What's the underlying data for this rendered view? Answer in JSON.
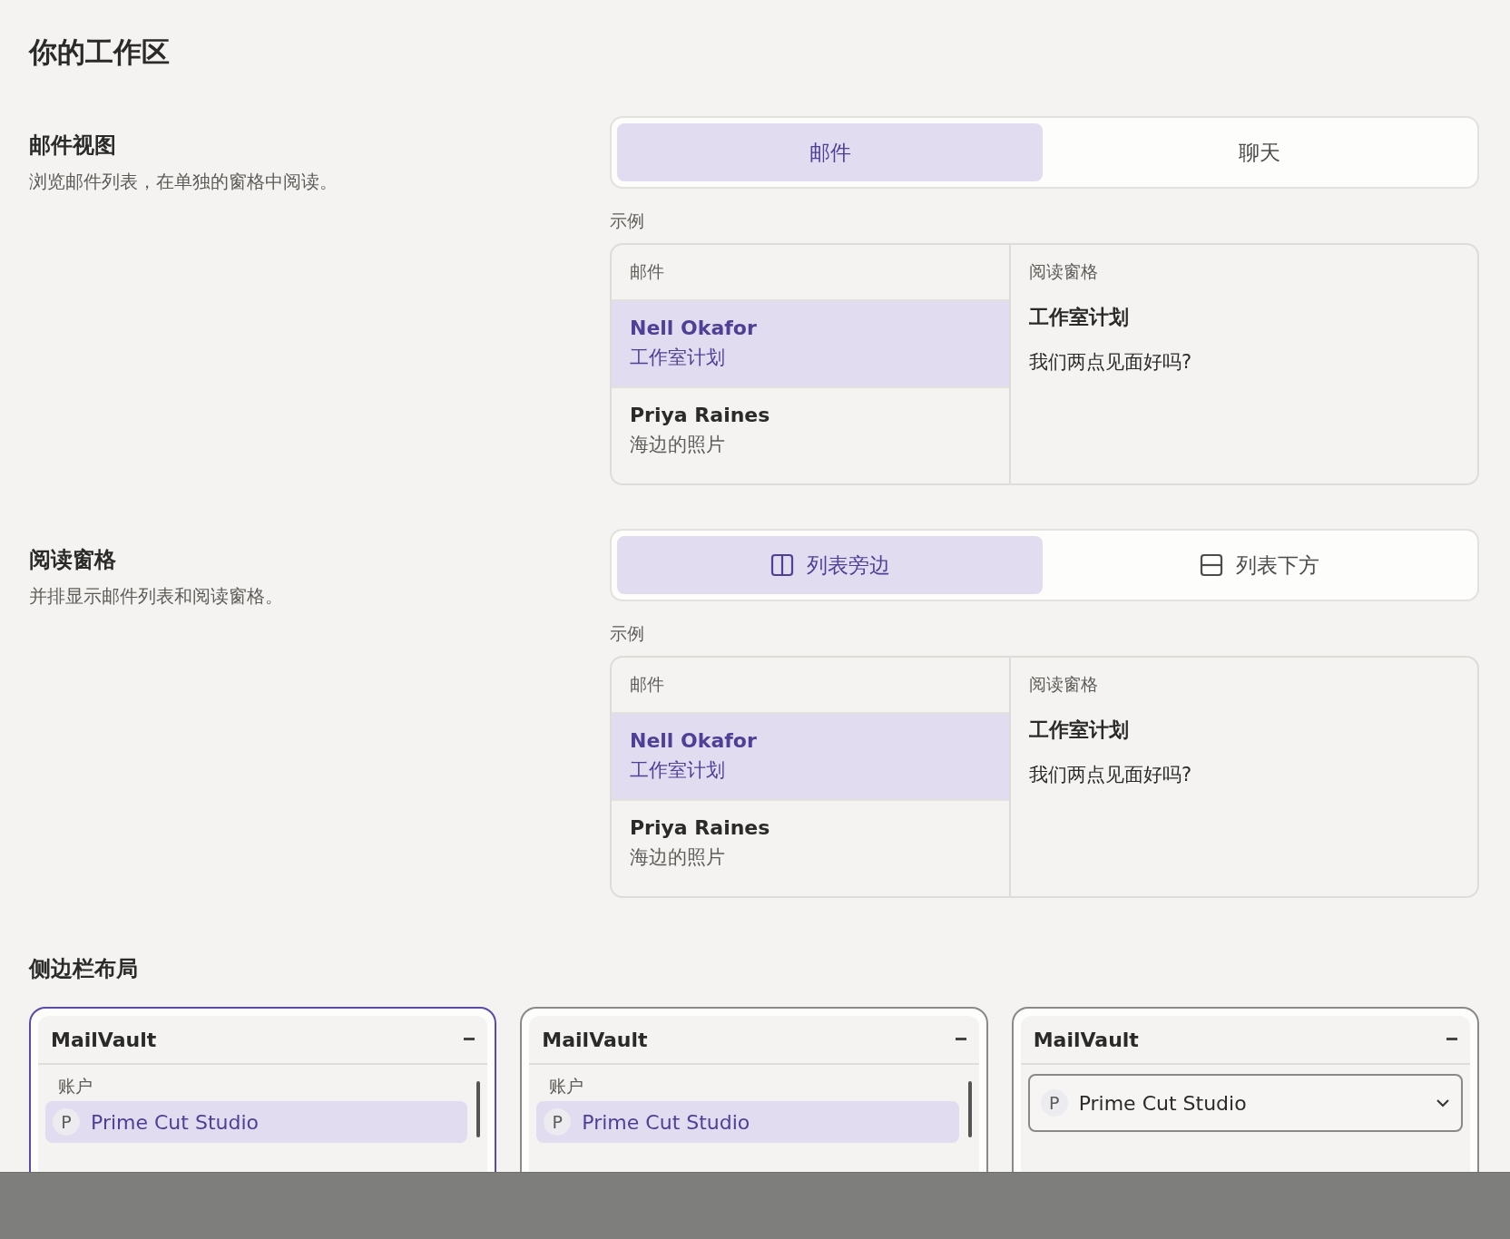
{
  "title": "你的工作区",
  "sections": [
    {
      "title": "邮件视图",
      "description": "浏览邮件列表，在单独的窗格中阅读。",
      "options": [
        {
          "label": "邮件",
          "kind": "plain",
          "selected": true
        },
        {
          "label": "聊天",
          "kind": "plain",
          "selected": false
        }
      ],
      "example_label": "示例",
      "example": {
        "list_header": "邮件",
        "messages": [
          {
            "sender": "Nell Okafor",
            "subject": "工作室计划",
            "selected": true
          },
          {
            "sender": "Priya Raines",
            "subject": "海边的照片",
            "selected": false
          }
        ],
        "pane_header": "阅读窗格",
        "pane_subject": "工作室计划",
        "pane_body": "我们两点见面好吗?"
      }
    },
    {
      "title": "阅读窗格",
      "description": "并排显示邮件列表和阅读窗格。",
      "options": [
        {
          "label": "列表旁边",
          "kind": "columns",
          "selected": true
        },
        {
          "label": "列表下方",
          "kind": "rows",
          "selected": false
        }
      ],
      "example_label": "示例",
      "example": {
        "list_header": "邮件",
        "messages": [
          {
            "sender": "Nell Okafor",
            "subject": "工作室计划",
            "selected": true
          },
          {
            "sender": "Priya Raines",
            "subject": "海边的照片",
            "selected": false
          }
        ],
        "pane_header": "阅读窗格",
        "pane_subject": "工作室计划",
        "pane_body": "我们两点见面好吗?"
      }
    }
  ],
  "sidebar_layout": {
    "title": "侧边栏布局",
    "cards": [
      {
        "selected": true,
        "kind": "list",
        "app_name": "MailVault",
        "accounts_label": "账户",
        "account": {
          "initial": "P",
          "name": "Prime Cut Studio",
          "selected": true
        }
      },
      {
        "selected": false,
        "kind": "list",
        "app_name": "MailVault",
        "accounts_label": "账户",
        "account": {
          "initial": "P",
          "name": "Prime Cut Studio",
          "selected": true
        }
      },
      {
        "selected": false,
        "kind": "dropdown",
        "app_name": "MailVault",
        "account": {
          "initial": "P",
          "name": "Prime Cut Studio"
        }
      }
    ]
  }
}
